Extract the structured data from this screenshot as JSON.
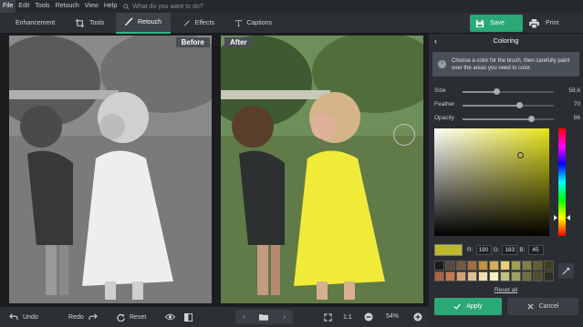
{
  "menu": {
    "items": [
      "File",
      "Edit",
      "Tools",
      "Retouch",
      "View",
      "Help"
    ],
    "active": "File",
    "search_placeholder": "What do you want to do?"
  },
  "toolbar": {
    "tabs": [
      {
        "label": "Enhancement",
        "icon": "sliders-icon"
      },
      {
        "label": "Tools",
        "icon": "crop-icon"
      },
      {
        "label": "Retouch",
        "icon": "brush-icon",
        "active": true
      },
      {
        "label": "Effects",
        "icon": "wand-icon"
      },
      {
        "label": "Captions",
        "icon": "text-icon"
      }
    ],
    "save_label": "Save",
    "print_label": "Print"
  },
  "images": {
    "before_label": "Before",
    "after_label": "After"
  },
  "bottombar": {
    "undo_label": "Undo",
    "redo_label": "Redo",
    "reset_label": "Reset",
    "ratio_label": "1:1",
    "zoom_value": "54%"
  },
  "panel": {
    "title": "Coloring",
    "info_text": "Choose a color for the brush, then carefully paint over the areas you need to color.",
    "sliders": [
      {
        "label": "Size",
        "value": "58,6",
        "fraction": 0.37
      },
      {
        "label": "Feather",
        "value": "70",
        "fraction": 0.62
      },
      {
        "label": "Opacity",
        "value": "86",
        "fraction": 0.75
      }
    ],
    "color": {
      "r": "190",
      "g": "183",
      "b": "45",
      "hex": "#beb72d"
    },
    "rgb_labels": {
      "r": "R:",
      "g": "G:",
      "b": "B:"
    },
    "swatches": [
      "#1a1a1a",
      "#5a4a3a",
      "#7a5a3a",
      "#a0703a",
      "#c49040",
      "#d8b050",
      "#e8d070",
      "#a0a050",
      "#808040",
      "#606030",
      "#404020",
      "#b06040",
      "#c87850",
      "#d8a070",
      "#e0c090",
      "#f0e0b0",
      "#f8f0c0",
      "#c0c080",
      "#a0a060",
      "#707040",
      "#505030",
      "#303020"
    ],
    "reset_all_label": "Reset all",
    "apply_label": "Apply",
    "cancel_label": "Cancel"
  },
  "colors": {
    "accent": "#2aa876",
    "panel_bg": "#2a2e33"
  }
}
